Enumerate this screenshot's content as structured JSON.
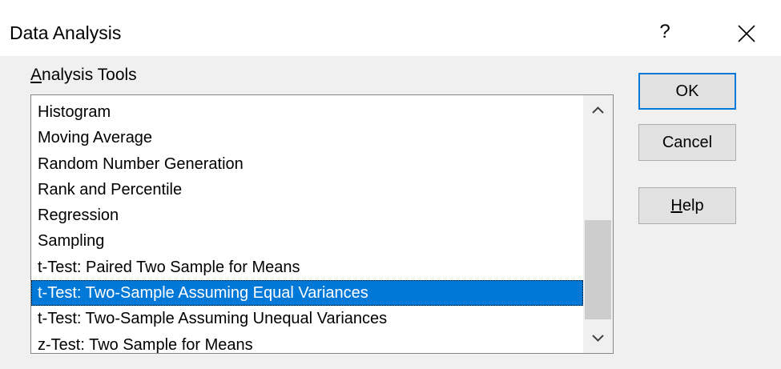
{
  "window": {
    "title": "Data Analysis",
    "help_glyph": "?",
    "close_icon": "close-icon"
  },
  "analysis_tools": {
    "label_accel": "A",
    "label_rest": "nalysis Tools",
    "items": [
      "Histogram",
      "Moving Average",
      "Random Number Generation",
      "Rank and Percentile",
      "Regression",
      "Sampling",
      "t-Test: Paired Two Sample for Means",
      "t-Test: Two-Sample Assuming Equal Variances",
      "t-Test: Two-Sample Assuming Unequal Variances",
      "z-Test: Two Sample for Means"
    ],
    "selected": "t-Test: Two-Sample Assuming Equal Variances"
  },
  "buttons": {
    "ok": "OK",
    "cancel": "Cancel",
    "help_accel": "H",
    "help_rest": "elp"
  },
  "colors": {
    "selection": "#0078d7",
    "dialog_bg": "#f0f0f0",
    "default_button_border": "#0078d7"
  }
}
